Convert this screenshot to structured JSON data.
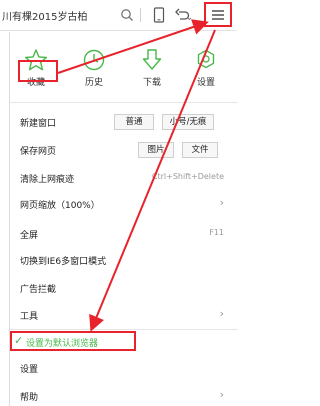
{
  "toolbar": {
    "title_text": "川有棵2015岁古柏",
    "search_icon": "search-icon",
    "device_icon": "tablet-icon",
    "undo_icon": "undo-icon",
    "menu_icon": "hamburger-menu-icon"
  },
  "quick_actions": [
    {
      "label": "收藏",
      "icon": "star-icon"
    },
    {
      "label": "历史",
      "icon": "history-clock-icon"
    },
    {
      "label": "下载",
      "icon": "download-arrow-icon"
    },
    {
      "label": "设置",
      "icon": "settings-gear-icon"
    }
  ],
  "menu": {
    "new_window": {
      "label": "新建窗口",
      "btn_normal": "普通",
      "btn_incognito": "小号/无痕"
    },
    "save_page": {
      "label": "保存网页",
      "btn_image": "图片",
      "btn_file": "文件"
    },
    "clear_trace": {
      "label": "清除上网痕迹",
      "shortcut": "Ctrl+Shift+Delete"
    },
    "zoom": {
      "label": "网页缩放（100%）"
    },
    "fullscreen": {
      "label": "全屏",
      "shortcut": "F11"
    },
    "ie6_mode": {
      "label": "切换到IE6多窗口模式"
    },
    "ad_block": {
      "label": "广告拦截"
    },
    "tools": {
      "label": "工具"
    },
    "default_browser": {
      "label": "设置为默认浏览器",
      "check_icon": "check-icon"
    },
    "settings": {
      "label": "设置"
    },
    "help": {
      "label": "帮助"
    }
  },
  "colors": {
    "accent_green": "#49b84a",
    "highlight_red": "#e8232b"
  }
}
